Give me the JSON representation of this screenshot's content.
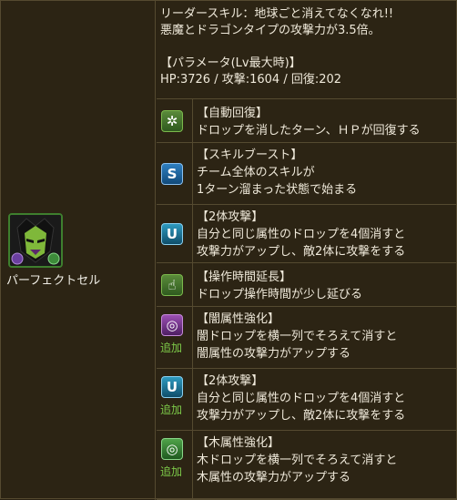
{
  "monster": {
    "name": "パーフェクトセル",
    "icon": "perfect-cell-portrait-icon"
  },
  "leader": {
    "skill_line": "リーダースキル：地球ごと消えてなくなれ!!",
    "skill_desc": "悪魔とドラゴンタイプの攻撃力が3.5倍。",
    "params_header": "【パラメータ(Lv最大時)】",
    "params": "HP:3726 / 攻撃:1604 / 回復:202"
  },
  "awakenings": [
    {
      "title": "【自動回復】",
      "lines": [
        "ドロップを消したターン、ＨＰが回復する"
      ],
      "icon": "auto-heal-icon",
      "plus": ""
    },
    {
      "title": "【スキルブースト】",
      "lines": [
        "チーム全体のスキルが",
        "1ターン溜まった状態で始まる"
      ],
      "icon": "skill-boost-icon",
      "plus": ""
    },
    {
      "title": "【2体攻撃】",
      "lines": [
        "自分と同じ属性のドロップを4個消すと",
        "攻撃力がアップし、敵2体に攻撃をする"
      ],
      "icon": "two-pronged-attack-icon",
      "plus": ""
    },
    {
      "title": "【操作時間延長】",
      "lines": [
        "ドロップ操作時間が少し延びる"
      ],
      "icon": "time-extend-icon",
      "plus": ""
    },
    {
      "title": "【闇属性強化】",
      "lines": [
        "闇ドロップを横一列でそろえて消すと",
        "闇属性の攻撃力がアップする"
      ],
      "icon": "dark-row-enhance-icon",
      "plus": "追加"
    },
    {
      "title": "【2体攻撃】",
      "lines": [
        "自分と同じ属性のドロップを4個消すと",
        "攻撃力がアップし、敵2体に攻撃をする"
      ],
      "icon": "two-pronged-attack-icon",
      "plus": "追加"
    },
    {
      "title": "【木属性強化】",
      "lines": [
        "木ドロップを横一列でそろえて消すと",
        "木属性の攻撃力がアップする"
      ],
      "icon": "wood-row-enhance-icon",
      "plus": "追加"
    }
  ]
}
